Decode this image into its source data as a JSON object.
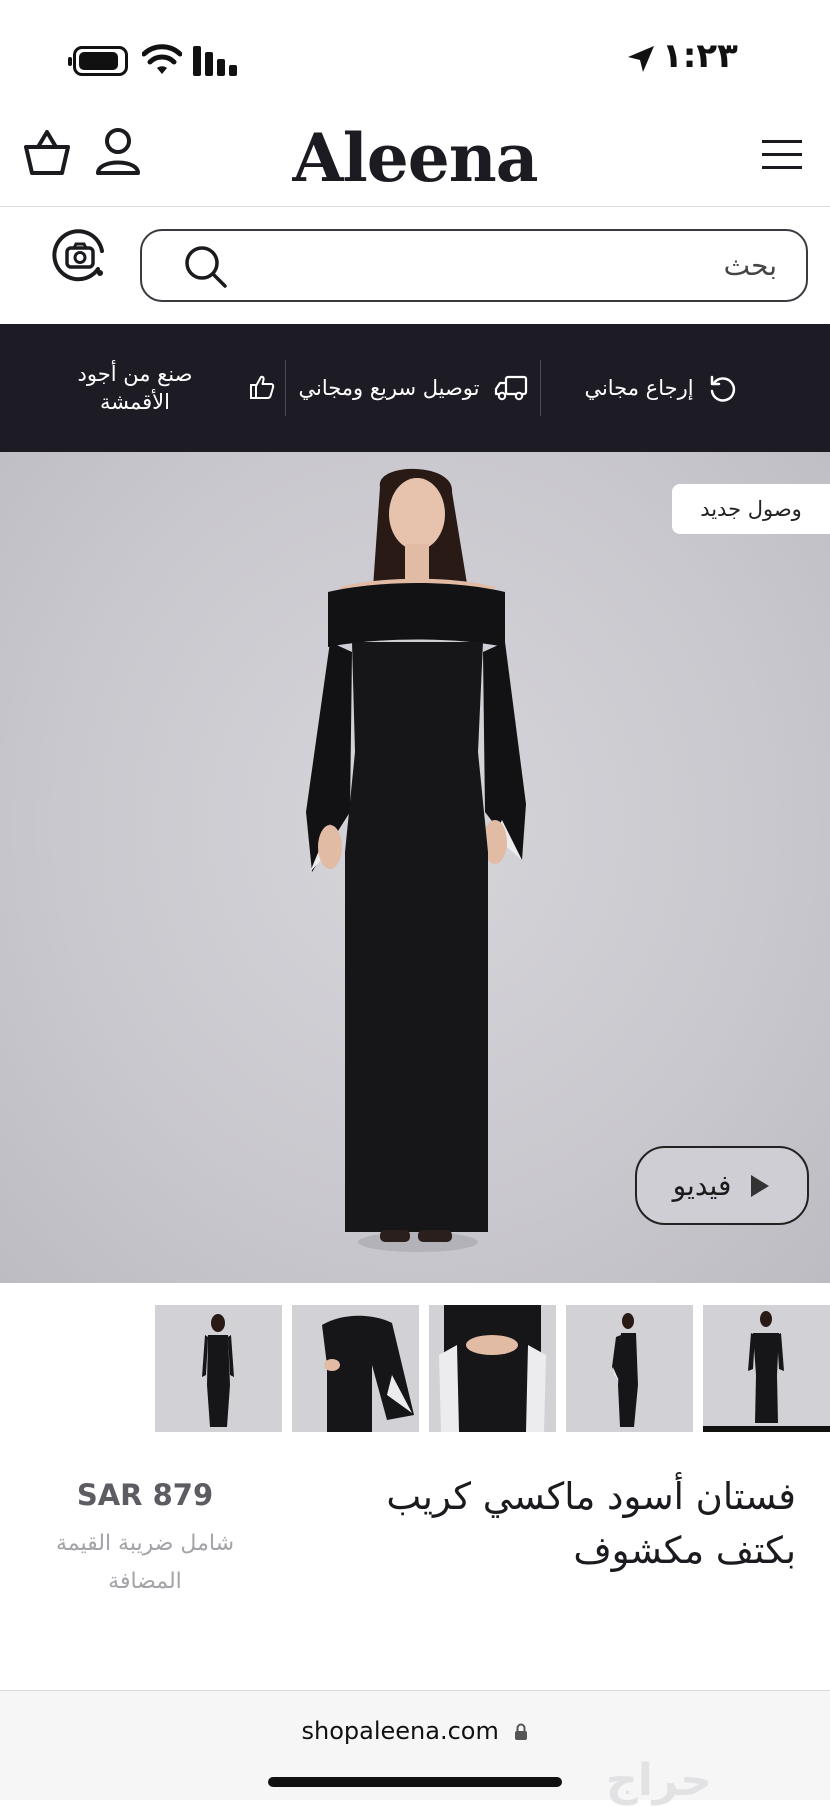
{
  "status_bar": {
    "time": "١:٢٣"
  },
  "header": {
    "brand": "Aleena"
  },
  "search": {
    "placeholder": "بحث"
  },
  "features": {
    "returns": "إرجاع مجاني",
    "delivery": "توصيل سريع ومجاني",
    "quality": "صنع من أجود الأقمشة"
  },
  "hero": {
    "badge": "وصول جديد",
    "video_label": "فيديو"
  },
  "product": {
    "title": "فستان أسود ماكسي كريب بكتف مكشوف",
    "price": "SAR 879",
    "vat_note": "شامل ضريبة القيمة المضافة"
  },
  "thumbnails": {
    "count_visible": 5,
    "selected_index": 4
  },
  "browser": {
    "url": "shopaleena.com"
  },
  "watermark": "حراج",
  "colors": {
    "band": "#1d1c24",
    "hero_bg": "#c9c8ce",
    "price": "#5c5c62",
    "vat": "#a3a3a8"
  }
}
